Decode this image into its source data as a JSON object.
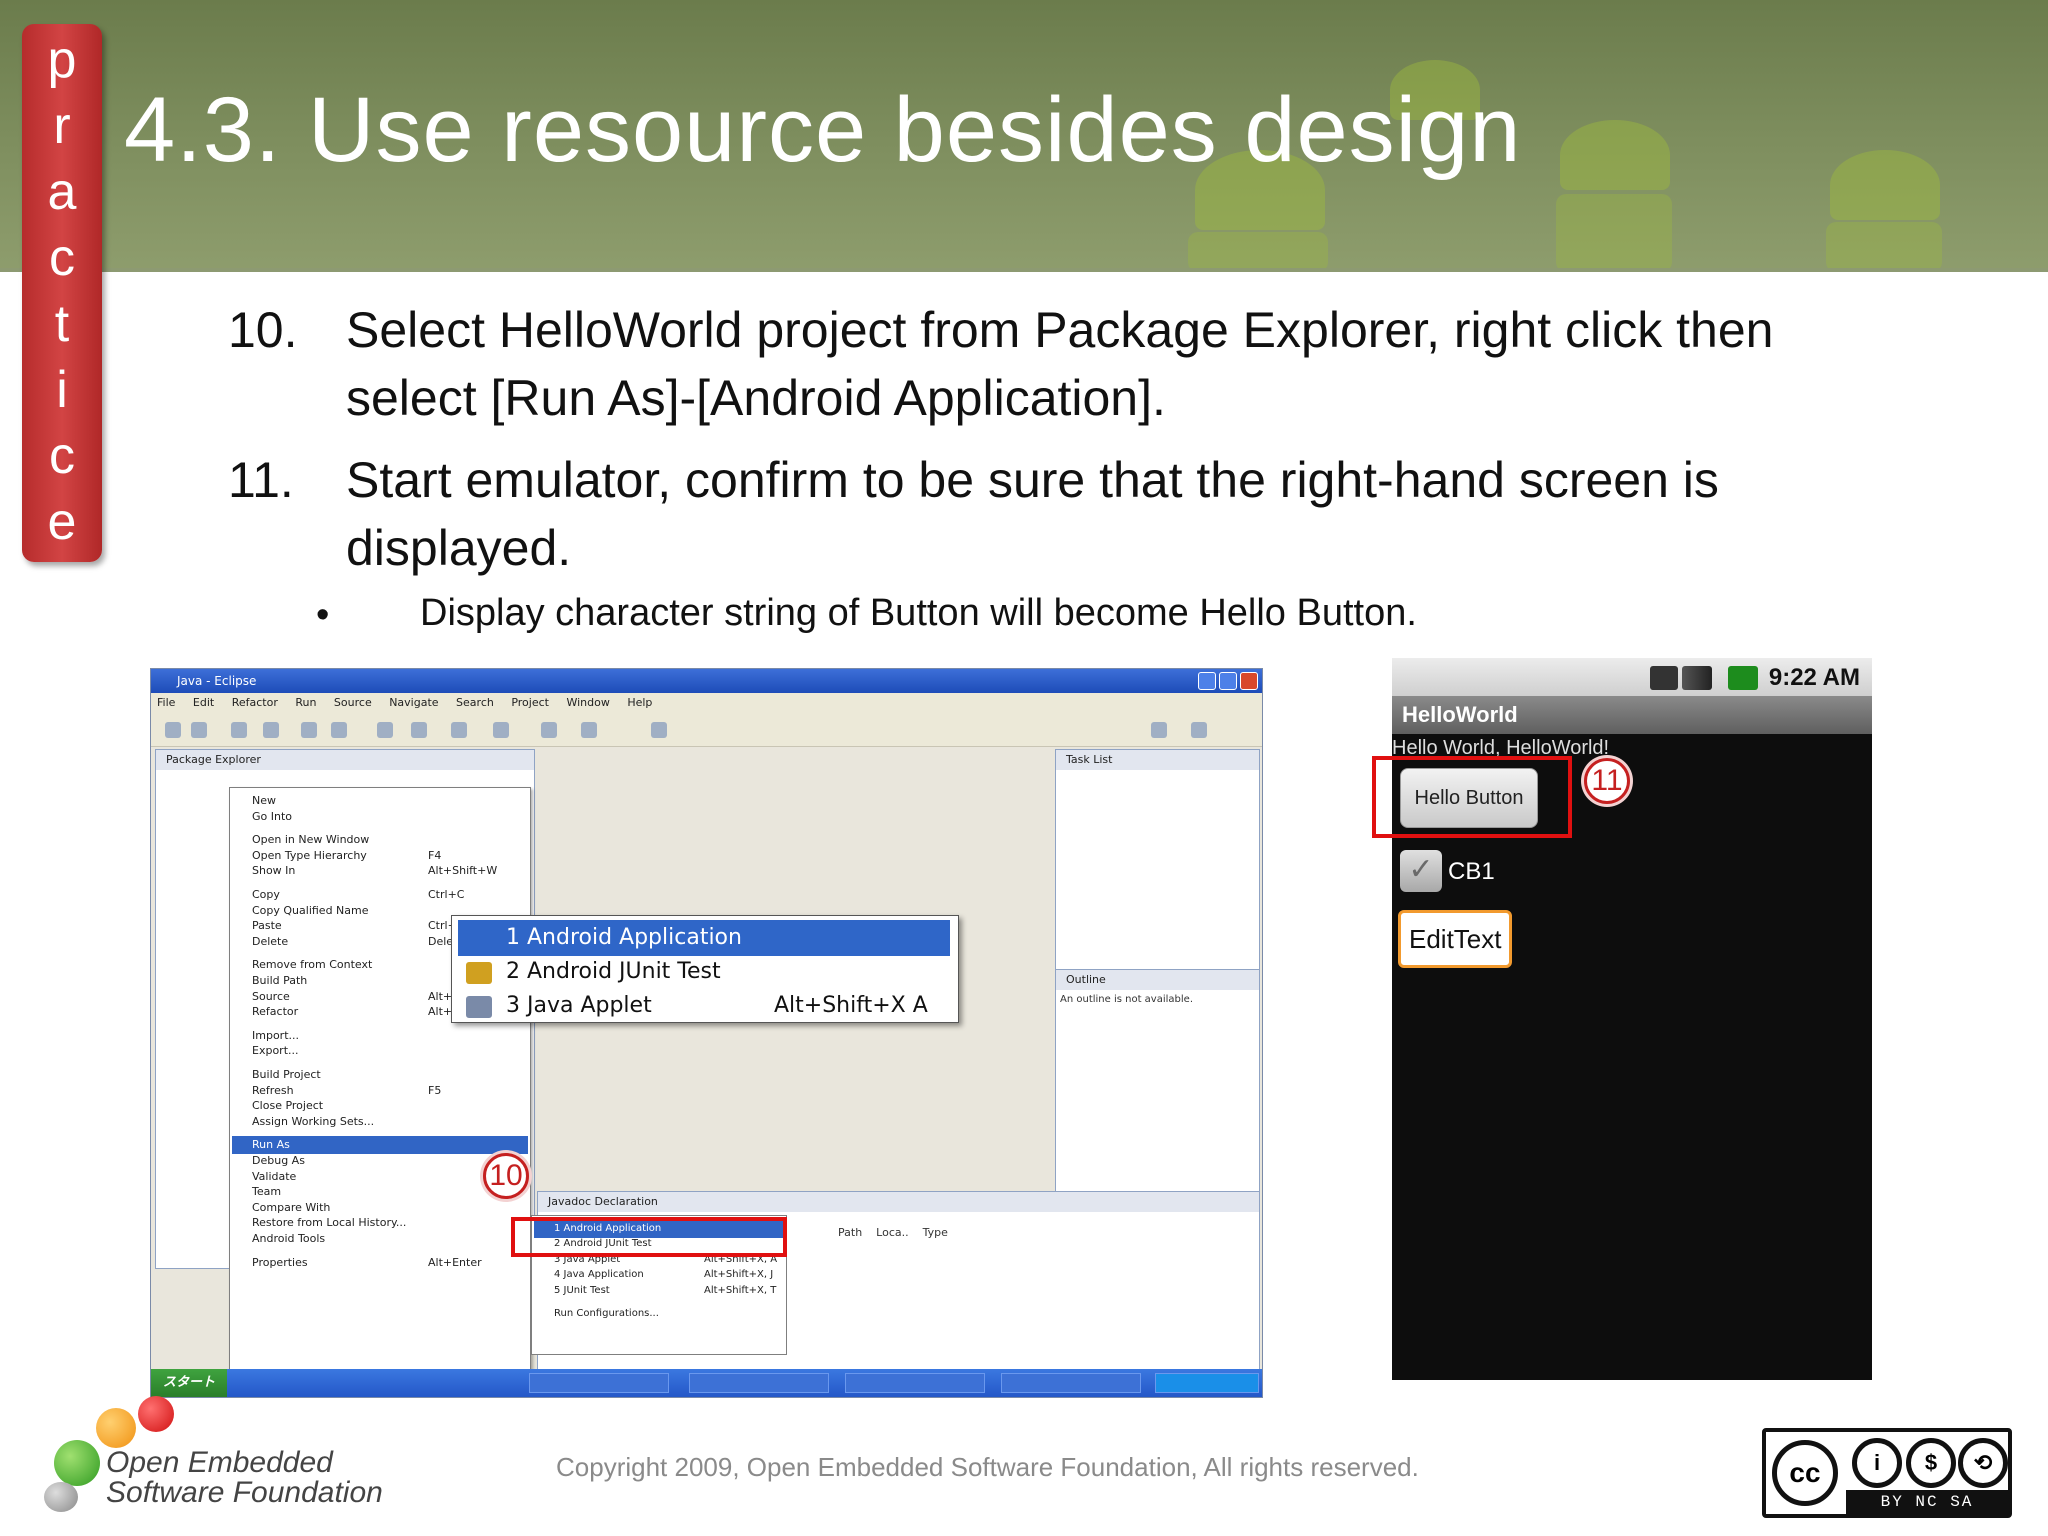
{
  "slide": {
    "title": "4.3. Use resource besides design",
    "side_tab_letters": [
      "p",
      "r",
      "a",
      "c",
      "t",
      "i",
      "c",
      "e"
    ],
    "steps": [
      {
        "number": "10.",
        "text": "Select HelloWorld project from Package Explorer, right click then select [Run As]-[Android Application]."
      },
      {
        "number": "11.",
        "text": "Start emulator, confirm to be sure that the right-hand screen is displayed."
      }
    ],
    "bullet": {
      "symbol": "•",
      "text": "Display character string of Button will become Hello Button."
    }
  },
  "eclipse": {
    "window_title": "Java - Eclipse",
    "menubar": "File Edit Refactor Run Source Navigate Search Project Window Help",
    "left_pane_tab": "Package Explorer",
    "task_pane_tab": "Task List",
    "outline_pane_tab": "Outline",
    "outline_text": "An outline is not available.",
    "bottom_pane_tab": "Javadoc  Declaration",
    "bottom_columns": "Path    Loca..    Type",
    "context_menu": [
      {
        "label": "New",
        "shortcut": ""
      },
      {
        "label": "Go Into",
        "shortcut": ""
      },
      {
        "label": "Open in New Window",
        "shortcut": ""
      },
      {
        "label": "Open Type Hierarchy",
        "shortcut": "F4"
      },
      {
        "label": "Show In",
        "shortcut": "Alt+Shift+W"
      },
      {
        "label": "Copy",
        "shortcut": "Ctrl+C"
      },
      {
        "label": "Copy Qualified Name",
        "shortcut": ""
      },
      {
        "label": "Paste",
        "shortcut": "Ctrl+V"
      },
      {
        "label": "Delete",
        "shortcut": "Delete"
      },
      {
        "label": "Remove from Context",
        "shortcut": ""
      },
      {
        "label": "Build Path",
        "shortcut": ""
      },
      {
        "label": "Source",
        "shortcut": "Alt+Shift+S"
      },
      {
        "label": "Refactor",
        "shortcut": "Alt+Shift+T"
      },
      {
        "label": "Import...",
        "shortcut": ""
      },
      {
        "label": "Export...",
        "shortcut": ""
      },
      {
        "label": "Build Project",
        "shortcut": ""
      },
      {
        "label": "Refresh",
        "shortcut": "F5"
      },
      {
        "label": "Close Project",
        "shortcut": ""
      },
      {
        "label": "Assign Working Sets...",
        "shortcut": ""
      },
      {
        "label": "Run As",
        "shortcut": ""
      },
      {
        "label": "Debug As",
        "shortcut": ""
      },
      {
        "label": "Validate",
        "shortcut": ""
      },
      {
        "label": "Team",
        "shortcut": ""
      },
      {
        "label": "Compare With",
        "shortcut": ""
      },
      {
        "label": "Restore from Local History...",
        "shortcut": ""
      },
      {
        "label": "Android Tools",
        "shortcut": ""
      },
      {
        "label": "Properties",
        "shortcut": "Alt+Enter"
      }
    ],
    "run_as_submenu": [
      {
        "label": "1 Android Application",
        "shortcut": ""
      },
      {
        "label": "2 Android JUnit Test",
        "shortcut": ""
      },
      {
        "label": "3 Java Applet",
        "shortcut": "Alt+Shift+X, A"
      },
      {
        "label": "4 Java Application",
        "shortcut": "Alt+Shift+X, J"
      },
      {
        "label": "5 JUnit Test",
        "shortcut": "Alt+Shift+X, T"
      },
      {
        "label": "Run Configurations...",
        "shortcut": ""
      }
    ],
    "zoom_menu": [
      {
        "label": "1 Android Application",
        "shortcut": ""
      },
      {
        "label": "2 Android JUnit Test",
        "shortcut": ""
      },
      {
        "label": "3 Java Applet",
        "shortcut": "Alt+Shift+X  A"
      }
    ],
    "start_button": "スタート",
    "step_badge": "10"
  },
  "android": {
    "time": "9:22 AM",
    "app_title": "HelloWorld",
    "hello_text": "Hello World, HelloWorld!",
    "button_label": "Hello Button",
    "checkbox_label": "CB1",
    "edittext_label": "EditText",
    "step_badge": "11"
  },
  "footer": {
    "logo_line1": "Open Embedded",
    "logo_line2": "Software Foundation",
    "copyright": "Copyright 2009, Open Embedded Software Foundation, All rights reserved.",
    "license_badge": "cc",
    "license_bar": "BY  NC  SA"
  },
  "colors": {
    "header_green": "#7f8f5f",
    "side_tab_red": "#c93838",
    "highlight_red": "#e01010",
    "selection_blue": "#3165c5",
    "edittext_orange": "#f29a2e"
  }
}
